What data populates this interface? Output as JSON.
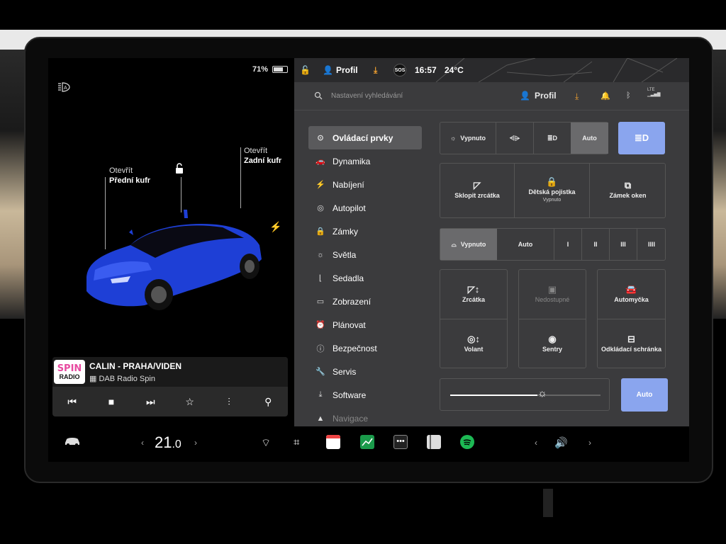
{
  "left": {
    "battery_percent": "71%",
    "battery_level": 0.71,
    "front_trunk": {
      "action": "Otevřít",
      "name": "Přední kufr"
    },
    "rear_trunk": {
      "action": "Otevřít",
      "name": "Zadní kufr"
    },
    "car_color": "#1e3fd6"
  },
  "media": {
    "logo_top": "SPIN",
    "logo_bottom": "RADIO",
    "song": "CALIN - PRAHA/VIDEN",
    "station": "DAB Radio Spin"
  },
  "status": {
    "profile": "Profil",
    "sos": "SOS",
    "time": "16:57",
    "temp": "24°C"
  },
  "search": {
    "placeholder": "Nastavení vyhledávání",
    "profile": "Profil",
    "lte": "LTE"
  },
  "menu": [
    {
      "label": "Ovládací prvky",
      "icon": "toggle-icon"
    },
    {
      "label": "Dynamika",
      "icon": "car-icon"
    },
    {
      "label": "Nabíjení",
      "icon": "bolt-icon"
    },
    {
      "label": "Autopilot",
      "icon": "steering-wheel-icon"
    },
    {
      "label": "Zámky",
      "icon": "lock-icon"
    },
    {
      "label": "Světla",
      "icon": "sun-icon"
    },
    {
      "label": "Sedadla",
      "icon": "seat-icon"
    },
    {
      "label": "Zobrazení",
      "icon": "display-icon"
    },
    {
      "label": "Plánovat",
      "icon": "alarm-icon"
    },
    {
      "label": "Bezpečnost",
      "icon": "info-icon"
    },
    {
      "label": "Servis",
      "icon": "wrench-icon"
    },
    {
      "label": "Software",
      "icon": "download-icon"
    },
    {
      "label": "Navigace",
      "icon": "navigation-icon"
    }
  ],
  "lights": {
    "off": "Vypnuto",
    "auto": "Auto"
  },
  "row2": {
    "fold_mirrors": "Sklopit zrcátka",
    "child_lock": "Dětská pojistka",
    "child_lock_state": "Vypnuto",
    "window_lock": "Zámek oken"
  },
  "wipers": {
    "off": "Vypnuto",
    "auto": "Auto",
    "speeds": [
      "I",
      "II",
      "III",
      "IIII"
    ]
  },
  "grid": {
    "mirrors": "Zrcátka",
    "unavailable": "Nedostupné",
    "carwash": "Automyčka",
    "steering": "Volant",
    "sentry": "Sentry",
    "glovebox": "Odkládací schránka"
  },
  "brightness": {
    "auto": "Auto",
    "level": 0.58
  },
  "bottom": {
    "temp_whole": "21",
    "temp_decimal": ".0",
    "left_chev": "‹",
    "right_chev": "›",
    "vol_left": "‹",
    "vol_right": "›"
  },
  "colors": {
    "accent": "#8aa5ee",
    "orange": "#f0a030",
    "spotify": "#1db954"
  }
}
